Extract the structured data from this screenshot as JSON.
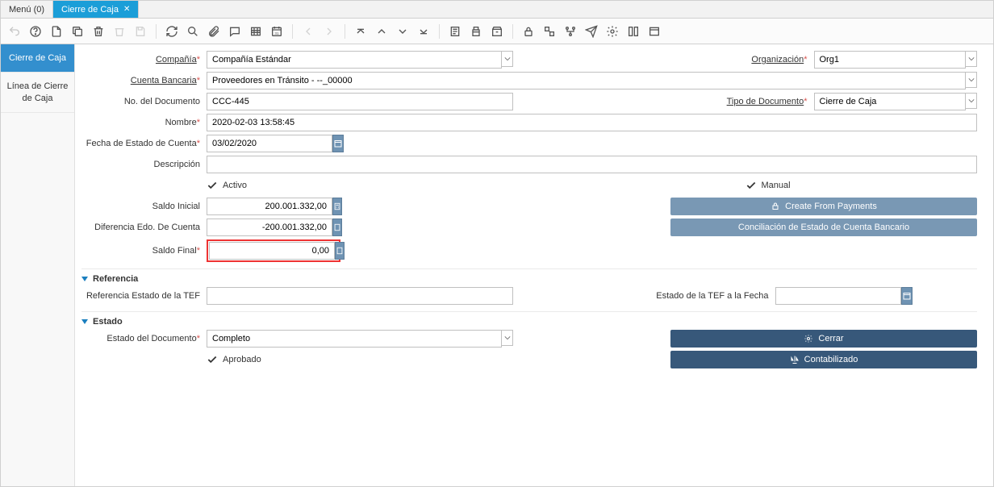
{
  "tabs": {
    "menu": "Menú (0)",
    "active": "Cierre de Caja"
  },
  "sidebar": {
    "items": [
      "Cierre de Caja",
      "Línea de Cierre de Caja"
    ]
  },
  "labels": {
    "compania": "Compañía",
    "organizacion": "Organización",
    "cuenta_bancaria": "Cuenta Bancaria",
    "no_documento": "No. del Documento",
    "tipo_documento": "Tipo de Documento",
    "nombre": "Nombre",
    "fecha_estado": "Fecha de Estado de Cuenta",
    "descripcion": "Descripción",
    "activo": "Activo",
    "manual": "Manual",
    "saldo_inicial": "Saldo Inicial",
    "dif_edo": "Diferencia Edo. De Cuenta",
    "saldo_final": "Saldo Final",
    "referencia": "Referencia",
    "ref_tef": "Referencia Estado de la TEF",
    "estado_tef_fecha": "Estado de la TEF a la Fecha",
    "estado": "Estado",
    "estado_doc": "Estado del Documento",
    "aprobado": "Aprobado"
  },
  "values": {
    "compania": "Compañía Estándar",
    "organizacion": "Org1",
    "cuenta_bancaria": "Proveedores en Tránsito - --_00000",
    "no_documento": "CCC-445",
    "tipo_documento": "Cierre de Caja",
    "nombre": "2020-02-03 13:58:45",
    "fecha_estado": "03/02/2020",
    "descripcion": "",
    "saldo_inicial": "200.001.332,00",
    "dif_edo": "-200.001.332,00",
    "saldo_final": "0,00",
    "ref_tef": "",
    "estado_tef_fecha": "",
    "estado_doc": "Completo"
  },
  "buttons": {
    "create_from_payments": "Create From Payments",
    "conciliacion": "Conciliación de Estado de Cuenta Bancario",
    "cerrar": "Cerrar",
    "contabilizado": "Contabilizado"
  }
}
